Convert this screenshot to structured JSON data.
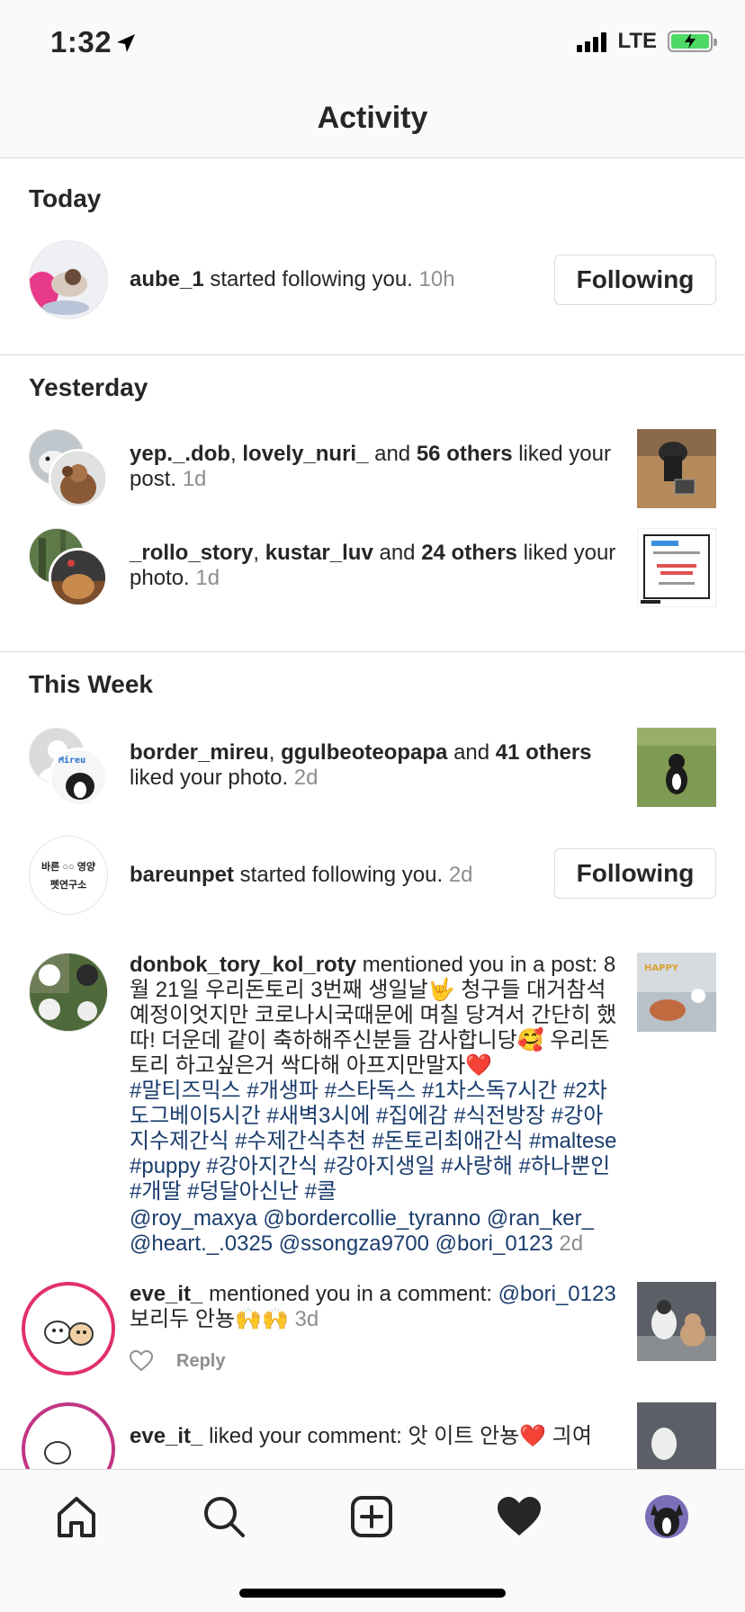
{
  "status_bar": {
    "time": "1:32",
    "network": "LTE"
  },
  "header": {
    "title": "Activity"
  },
  "sections": [
    {
      "title": "Today"
    },
    {
      "title": "Yesterday"
    },
    {
      "title": "This Week"
    }
  ],
  "items": {
    "aube": {
      "user": "aube_1",
      "action": " started following you. ",
      "time": "10h",
      "button": "Following"
    },
    "yep": {
      "user1": "yep._.dob",
      "sep": ", ",
      "user2": "lovely_nuri_",
      "and": " and ",
      "others": "56 others",
      "action": " liked your post. ",
      "time": "1d"
    },
    "rollo": {
      "user1": "_rollo_story",
      "sep": ", ",
      "user2": "kustar_luv",
      "and": " and ",
      "others": "24 others",
      "action": " liked your photo. ",
      "time": "1d"
    },
    "border": {
      "user1": "border_mireu",
      "sep": ", ",
      "user2": "ggulbeoteopapa",
      "and": " and ",
      "others": "41 others",
      "action": " liked your photo. ",
      "time": "2d"
    },
    "bareun": {
      "user": "bareunpet",
      "action": " started following you. ",
      "time": "2d",
      "button": "Following",
      "avatar_text_top": "바른",
      "avatar_text_mid": "영양",
      "avatar_text_bottom": "펫연구소"
    },
    "donbok": {
      "user": "donbok_tory_kol_roty",
      "action": " mentioned you in a post: ",
      "caption": "8월 21일 우리돈토리 3번째 생일날🤟 청구들 대거참석 예정이엇지만 코로나시국때문에 며칠 당겨서 간단히 했따! 더운데 같이 축하해주신분들 감사합니당🥰 우리돈토리 하고싶은거 싹다해 아프지만말자❤️",
      "hashtags": "#말티즈믹스 #개생파 #스타독스 #1차스독7시간 #2차도그베이5시간 #새벽3시에 #집에감 #식전방장 #강아지수제간식 #수제간식추천 #돈토리최애간식 #maltese #puppy #강아지간식 #강아지생일 #사랑해 #하나뿐인 #개딸 #덩달아신난 #콜",
      "mentions": "@roy_maxya @bordercollie_tyranno @ran_ker_ @heart._.0325 @ssongza9700 @bori_0123",
      "time": "2d"
    },
    "eve1": {
      "user": "eve_it_",
      "action": " mentioned you in a comment: ",
      "mention": "@bori_0123",
      "text": " 보리두 안뇽🙌🙌 ",
      "time": "3d",
      "reply": "Reply"
    },
    "eve2": {
      "user": "eve_it_",
      "action": " liked your comment: 앗 이트 안뇽❤️ 긔여"
    }
  },
  "tab_bar": {
    "tabs": [
      "home-icon",
      "search-icon",
      "new-post-icon",
      "activity-heart-icon",
      "profile-avatar"
    ]
  },
  "colors": {
    "hashtag": "#1b3d6d",
    "muted": "#8e8e8e",
    "story_ring": "#c13584",
    "battery": "#4cd964"
  }
}
